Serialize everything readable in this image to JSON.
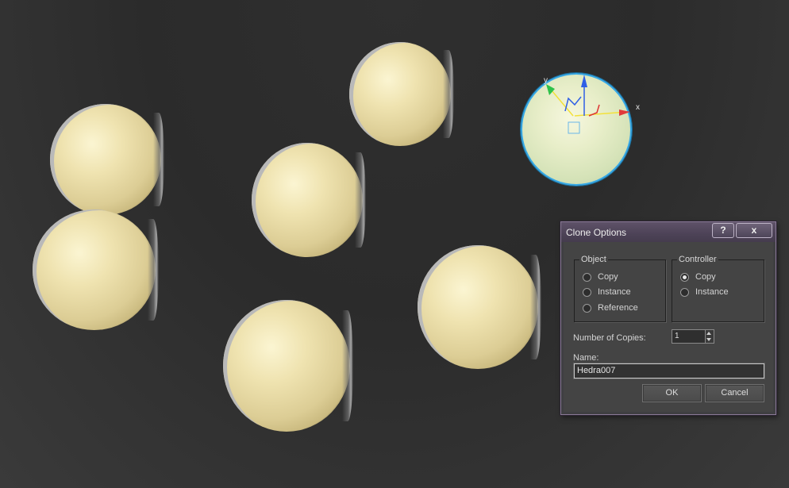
{
  "viewport": {
    "objects": [
      {
        "name": "sphere",
        "selected": false
      },
      {
        "name": "sphere",
        "selected": false
      },
      {
        "name": "sphere",
        "selected": false
      },
      {
        "name": "sphere",
        "selected": false
      },
      {
        "name": "sphere",
        "selected": false
      },
      {
        "name": "sphere",
        "selected": false
      },
      {
        "name": "sphere",
        "selected": false
      },
      {
        "name": "sphere",
        "selected": true
      }
    ],
    "gizmo": {
      "x_label": "x",
      "y_label": "y",
      "x_color": "#e03a3a",
      "y_color": "#2ec24a",
      "z_color": "#2f5fe6"
    },
    "selection_color": "#36a8e6"
  },
  "dialog": {
    "title": "Clone Options",
    "help_label": "?",
    "close_label": "x",
    "object_group": {
      "label": "Object",
      "options": [
        {
          "label": "Copy",
          "checked": false
        },
        {
          "label": "Instance",
          "checked": false
        },
        {
          "label": "Reference",
          "checked": false
        }
      ]
    },
    "controller_group": {
      "label": "Controller",
      "options": [
        {
          "label": "Copy",
          "checked": true
        },
        {
          "label": "Instance",
          "checked": false
        }
      ]
    },
    "copies_label": "Number of Copies:",
    "copies_value": "1",
    "name_label": "Name:",
    "name_value": "Hedra007",
    "ok_label": "OK",
    "cancel_label": "Cancel"
  }
}
